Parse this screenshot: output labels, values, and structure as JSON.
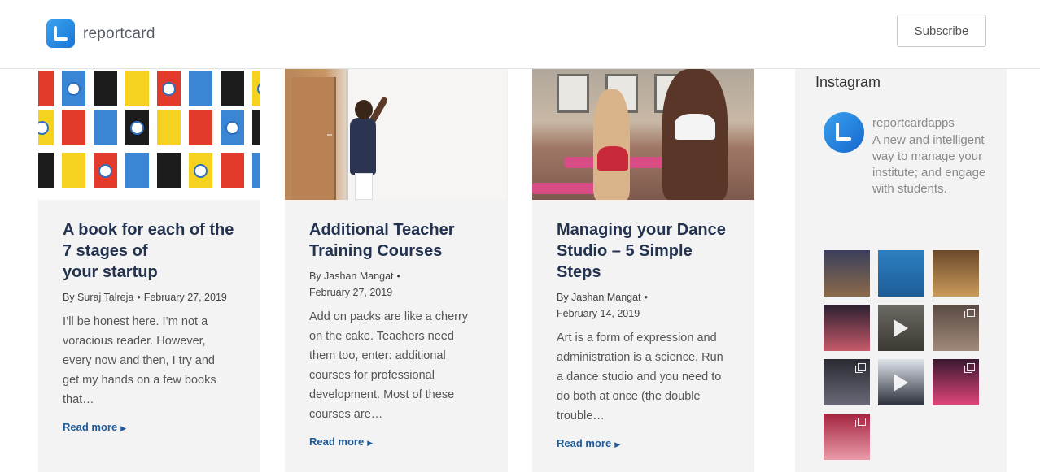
{
  "header": {
    "brand": "reportcard",
    "subscribe_label": "Subscribe"
  },
  "posts": [
    {
      "title_lines": [
        "A book for each of the",
        "7 stages of",
        "your startup"
      ],
      "author": "By Suraj Talreja",
      "date": "February 27, 2019",
      "excerpt": "I’ll be honest here. I’m not a voracious reader. However, every now and then, I try and get my hands on a few books that…",
      "read_more": "Read more",
      "image": "book-covers-grid"
    },
    {
      "title_lines": [
        "Additional Teacher",
        "Training Courses"
      ],
      "author": "By Jashan Mangat",
      "date": "February 27, 2019",
      "excerpt": "Add on packs are like a cherry on the cake. Teachers need them too, enter: additional courses for professional development. Most of these courses are…",
      "read_more": "Read more",
      "image": "teacher-at-whiteboard"
    },
    {
      "title_lines": [
        "Managing your Dance",
        "Studio – 5 Simple",
        "Steps"
      ],
      "author": "By Jashan Mangat",
      "date": "February 14, 2019",
      "excerpt": "Art is a form of expression and administration is a science. Run a dance studio and you need to do both at once (the double trouble…",
      "read_more": "Read more",
      "image": "dance-class"
    }
  ],
  "sidebar": {
    "title": "Instagram",
    "username": "reportcardapps",
    "bio": "A new and intelligent way to manage your institute; and engage with students.",
    "thumb_count": 10
  },
  "colors": {
    "accent": "#1e5a9a",
    "title": "#22324f",
    "card_bg": "#f3f3f3",
    "brand_blue": "#1876d6"
  }
}
